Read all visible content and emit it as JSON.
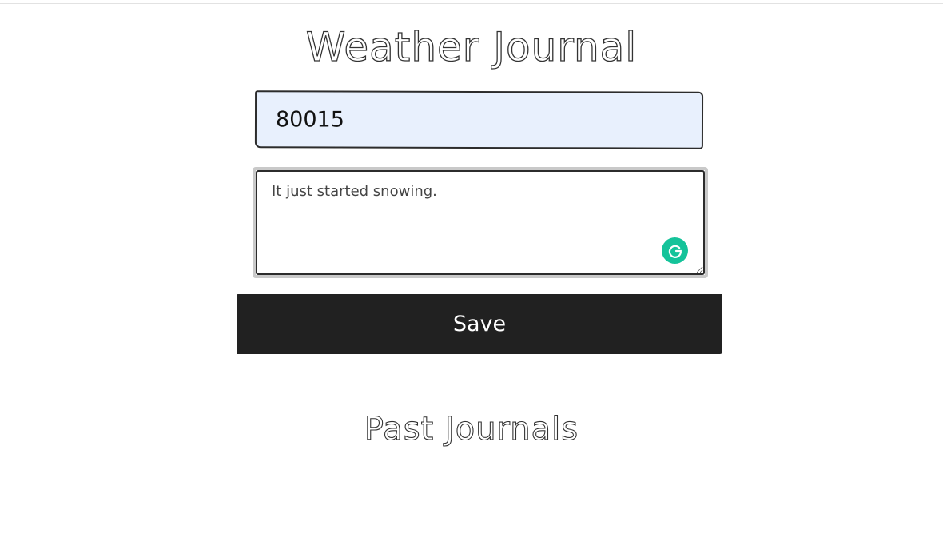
{
  "header": {
    "title": "Weather Journal"
  },
  "form": {
    "zip_value": "80015",
    "feelings_value": "It just started snowing.",
    "save_label": "Save"
  },
  "history": {
    "title": "Past Journals"
  },
  "icons": {
    "grammarly": "grammarly-icon"
  },
  "colors": {
    "zip_background": "#e8f0fd",
    "button_background": "#212121",
    "grammarly_green": "#15c39a"
  }
}
